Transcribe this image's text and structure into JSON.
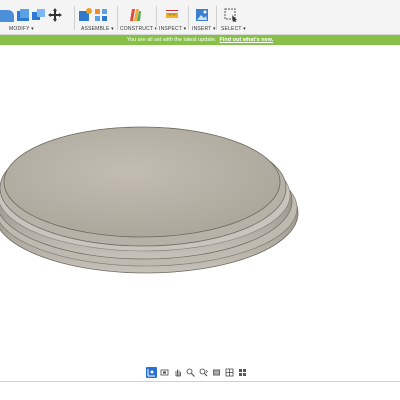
{
  "toolbar": {
    "modify_label": "MODIFY ▾",
    "assemble_label": "ASSEMBLE ▾",
    "construct_label": "CONSTRUCT ▾",
    "inspect_label": "INSPECT ▾",
    "insert_label": "INSERT ▾",
    "select_label": "SELECT ▾",
    "icons": [
      "fillet-icon",
      "shell-icon",
      "combine-icon",
      "move-icon",
      "new-component-icon",
      "joint-icon",
      "offset-plane-icon",
      "measure-icon",
      "insert-image-icon",
      "select-window-icon"
    ]
  },
  "banner": {
    "message": "You are all set with the latest update.",
    "link": "Find out what's new."
  },
  "viewport": {
    "model": "round-base-disc",
    "colors": {
      "face": "#b8b3a8",
      "rim": "#9f9a90",
      "accent": "#86c046"
    }
  },
  "navbar": {
    "buttons": [
      "orbit-icon",
      "look-at-icon",
      "pan-icon",
      "zoom-icon",
      "fit-icon",
      "display-settings-icon",
      "grid-icon",
      "viewports-icon"
    ]
  }
}
